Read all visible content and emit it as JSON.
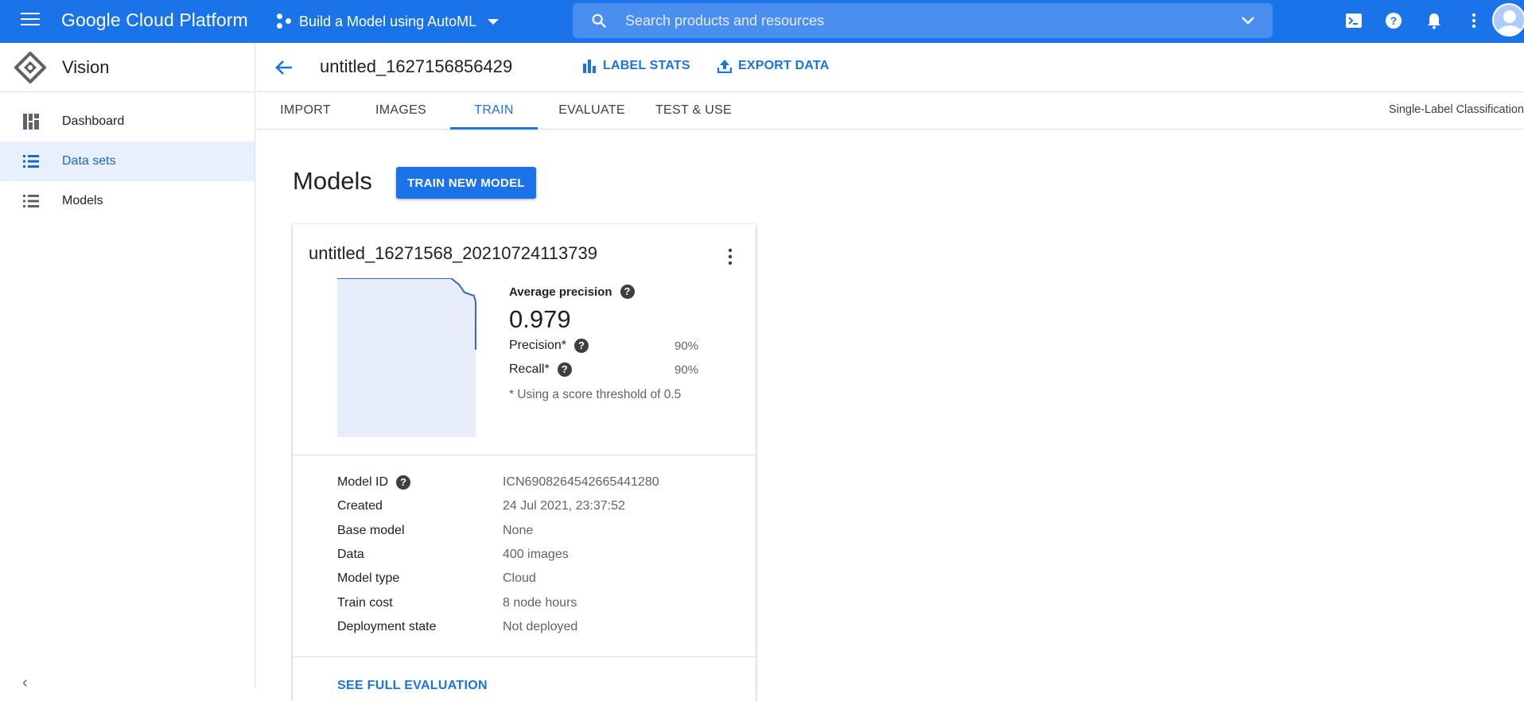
{
  "topbar": {
    "brand": "Google Cloud Platform",
    "project": "Build a Model using AutoML",
    "search_placeholder": "Search products and resources"
  },
  "sidebar": {
    "title": "Vision",
    "items": [
      {
        "label": "Dashboard",
        "icon": "dashboard-icon",
        "active": false
      },
      {
        "label": "Data sets",
        "icon": "list-icon",
        "active": true
      },
      {
        "label": "Models",
        "icon": "list-icon",
        "active": false
      }
    ]
  },
  "header": {
    "dataset_title": "untitled_1627156856429",
    "label_stats": "LABEL STATS",
    "export_data": "EXPORT DATA"
  },
  "tabs": {
    "items": [
      "IMPORT",
      "IMAGES",
      "TRAIN",
      "EVALUATE",
      "TEST & USE"
    ],
    "active": "TRAIN",
    "classification": "Single-Label Classification"
  },
  "main": {
    "title": "Models",
    "train_button": "TRAIN NEW MODEL"
  },
  "model_card": {
    "name": "untitled_16271568_20210724113739",
    "average_precision_label": "Average precision",
    "average_precision": "0.979",
    "precision_label": "Precision*",
    "precision": "90%",
    "recall_label": "Recall*",
    "recall": "90%",
    "note": "* Using a score threshold of 0.5",
    "details": [
      {
        "key": "Model ID",
        "value": "ICN6908264542665441280",
        "help": true
      },
      {
        "key": "Created",
        "value": "24 Jul 2021, 23:37:52",
        "help": false
      },
      {
        "key": "Base model",
        "value": "None",
        "help": false
      },
      {
        "key": "Data",
        "value": "400 images",
        "help": false
      },
      {
        "key": "Model type",
        "value": "Cloud",
        "help": false
      },
      {
        "key": "Train cost",
        "value": "8 node hours",
        "help": false
      },
      {
        "key": "Deployment state",
        "value": "Not deployed",
        "help": false
      }
    ],
    "see_full": "SEE FULL EVALUATION"
  },
  "colors": {
    "brand_blue": "#1a73e8",
    "active_nav_bg": "#e8f0fe",
    "chart_fill": "#e8eef9",
    "chart_line": "#3367d6"
  }
}
